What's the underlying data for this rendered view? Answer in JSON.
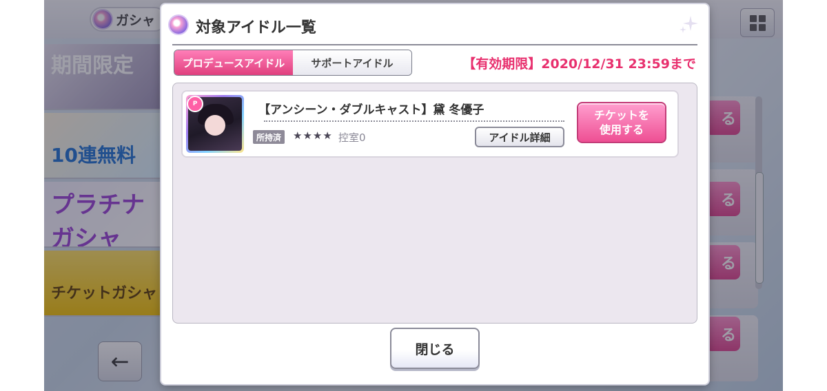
{
  "background": {
    "header": {
      "gacha_tab_label": "ガシャ"
    },
    "banners": [
      {
        "label": "期間限定"
      },
      {
        "label": "10連無料"
      },
      {
        "label": "プラチナガシャ"
      },
      {
        "label": "チケットガシャ"
      }
    ],
    "back_icon": "left-arrow-icon",
    "grid_icon": "grid-menu-icon",
    "use_buttons": [
      "る",
      "る",
      "る",
      "る"
    ]
  },
  "modal": {
    "title": "対象アイドル一覧",
    "title_icon": "gacha-orb-icon",
    "tabs": [
      {
        "label": "プロデュースアイドル",
        "active": true
      },
      {
        "label": "サポートアイドル",
        "active": false
      }
    ],
    "validity": "【有効期限】2020/12/31 23:59まで",
    "idols": [
      {
        "name": "【アンシーン・ダブルキャスト】黛 冬優子",
        "type_badge": "P",
        "owned_label": "所持済",
        "stars": "★★★★",
        "room": "控室0",
        "detail_label": "アイドル詳細",
        "use_ticket_label": "チケットを\n使用する"
      }
    ],
    "close_label": "閉じる"
  },
  "colors": {
    "accent_pink": "#e8306e",
    "tab_active": "#e0407e",
    "panel_bg": "#ece7ef"
  }
}
